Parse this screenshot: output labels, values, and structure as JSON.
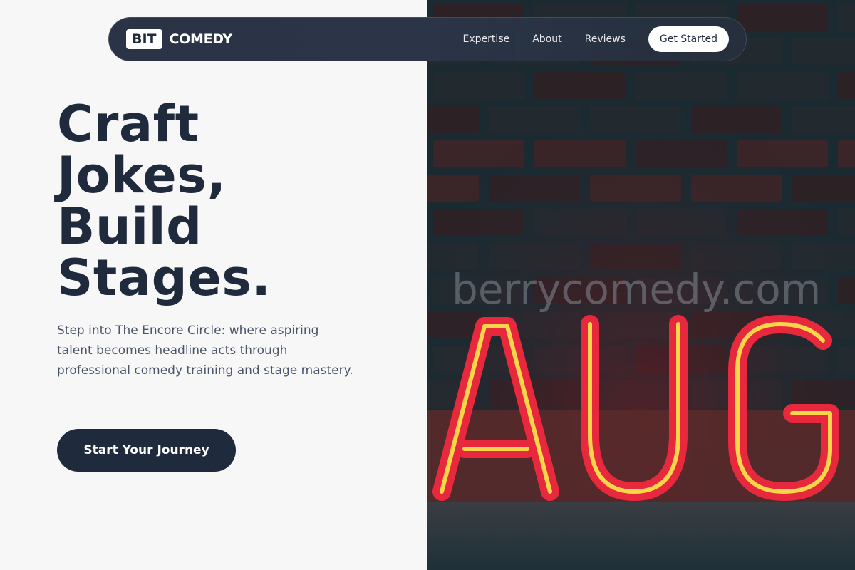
{
  "brand": {
    "logo_box": "BIT",
    "logo_text": "COMEDY"
  },
  "nav": {
    "links": [
      "Expertise",
      "About",
      "Reviews"
    ],
    "cta": "Get Started"
  },
  "hero": {
    "headline_lines": [
      "Craft",
      "Jokes,",
      "Build",
      "Stages."
    ],
    "subtext": "Step into The Encore Circle: where aspiring talent becomes headline acts through professional comedy training and stage mastery.",
    "cta": "Start Your Journey"
  },
  "image": {
    "neon_letters": "AUG",
    "watermark": "berrycomedy.com"
  },
  "colors": {
    "primary": "#1f2a3d",
    "background": "#f7f7f7",
    "neon_red": "#e8283c",
    "neon_yellow": "#f7d64a"
  }
}
